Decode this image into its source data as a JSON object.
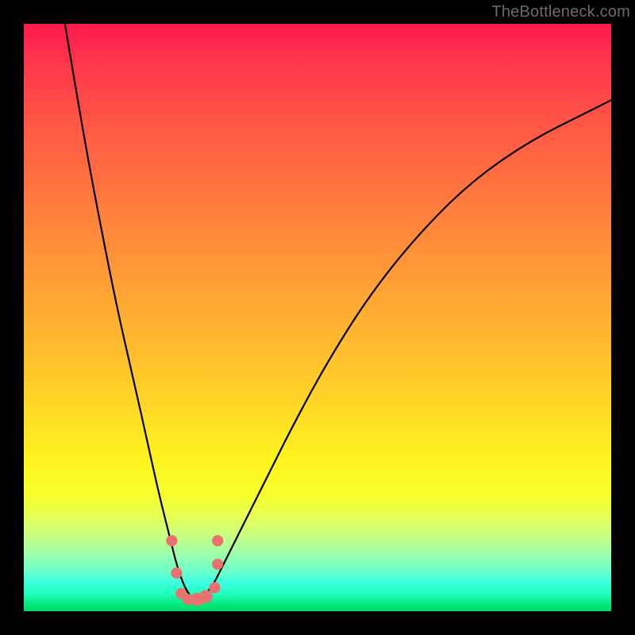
{
  "watermark": {
    "text": "TheBottleneck.com"
  },
  "chart_data": {
    "type": "line",
    "title": "",
    "xlabel": "",
    "ylabel": "",
    "xlim": [
      0,
      100
    ],
    "ylim": [
      0,
      100
    ],
    "series": [
      {
        "name": "bottleneck-curve",
        "x": [
          7,
          10,
          13,
          16,
          19,
          21,
          23,
          25,
          26,
          27,
          28,
          29,
          30,
          32,
          34,
          37,
          41,
          46,
          52,
          59,
          67,
          76,
          86,
          96,
          100
        ],
        "values": [
          100,
          82,
          66,
          51,
          38,
          29,
          20,
          12,
          8,
          5,
          3,
          2,
          2,
          4,
          8,
          14,
          22,
          32,
          43,
          54,
          64,
          73,
          80,
          85,
          87
        ]
      }
    ],
    "markers": {
      "name": "highlight-points",
      "color": "#e9716f",
      "points": [
        {
          "x": 25.2,
          "y": 12.0,
          "r": 1.2
        },
        {
          "x": 26.0,
          "y": 6.5,
          "r": 1.2
        },
        {
          "x": 26.8,
          "y": 3.0,
          "r": 1.2
        },
        {
          "x": 28.0,
          "y": 2.0,
          "r": 1.2
        },
        {
          "x": 29.5,
          "y": 2.0,
          "r": 1.4
        },
        {
          "x": 31.0,
          "y": 2.5,
          "r": 1.4
        },
        {
          "x": 32.5,
          "y": 4.0,
          "r": 1.2
        },
        {
          "x": 33.0,
          "y": 8.0,
          "r": 1.2
        },
        {
          "x": 33.0,
          "y": 12.0,
          "r": 1.2
        }
      ]
    },
    "background_gradient": {
      "top": "#ff1a4d",
      "mid1": "#ff9a36",
      "mid2": "#fff31e",
      "bottom": "#00d860"
    }
  }
}
